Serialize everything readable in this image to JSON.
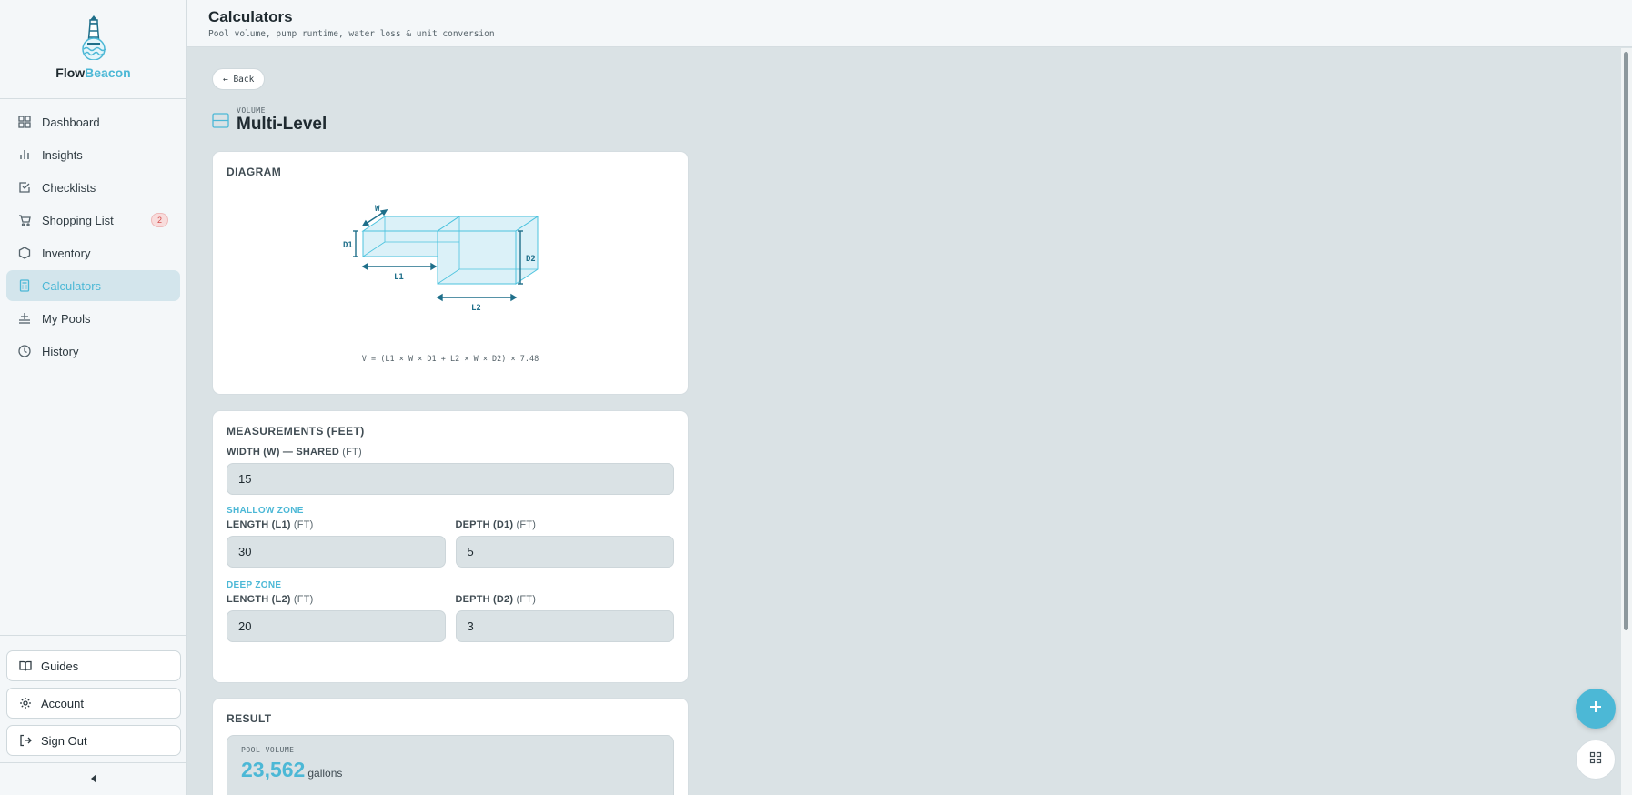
{
  "brand": {
    "name_part1": "Flow",
    "name_part2": "Beacon"
  },
  "sidebar": {
    "items": [
      {
        "label": "Dashboard",
        "icon": "grid-icon"
      },
      {
        "label": "Insights",
        "icon": "bar-chart-icon"
      },
      {
        "label": "Checklists",
        "icon": "checkbox-icon"
      },
      {
        "label": "Shopping List",
        "icon": "cart-icon",
        "badge": "2"
      },
      {
        "label": "Inventory",
        "icon": "hexagon-icon"
      },
      {
        "label": "Calculators",
        "icon": "calculator-icon",
        "active": true
      },
      {
        "label": "My Pools",
        "icon": "pool-icon"
      },
      {
        "label": "History",
        "icon": "clock-icon"
      }
    ],
    "bottom": {
      "guides": "Guides",
      "account": "Account",
      "signout": "Sign Out"
    }
  },
  "header": {
    "title": "Calculators",
    "subtitle": "Pool volume, pump runtime, water loss & unit conversion"
  },
  "main": {
    "back_label": "← Back",
    "kicker": "VOLUME",
    "title": "Multi-Level",
    "diagram": {
      "heading": "DIAGRAM",
      "labels": {
        "w": "W",
        "d1": "D1",
        "d2": "D2",
        "l1": "L1",
        "l2": "L2"
      },
      "formula": "V = (L1 × W × D1 + L2 × W × D2) × 7.48"
    },
    "measurements": {
      "heading": "MEASUREMENTS (FEET)",
      "width_label": "WIDTH (W) — SHARED",
      "unit": "(FT)",
      "width_value": "15",
      "shallow_zone": "SHALLOW ZONE",
      "l1_label": "LENGTH (L1)",
      "l1_value": "30",
      "d1_label": "DEPTH (D1)",
      "d1_value": "5",
      "deep_zone": "DEEP ZONE",
      "l2_label": "LENGTH (L2)",
      "l2_value": "20",
      "d2_label": "DEPTH (D2)",
      "d2_value": "3"
    },
    "result": {
      "heading": "RESULT",
      "kicker": "POOL VOLUME",
      "value": "23,562",
      "unit": "gallons"
    }
  },
  "colors": {
    "accent": "#4cb8d6",
    "background": "#dae2e5",
    "badge": "#d24d4d"
  }
}
